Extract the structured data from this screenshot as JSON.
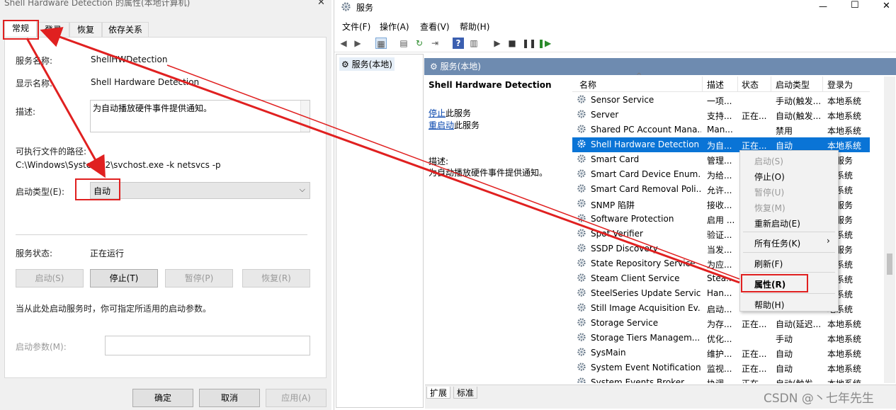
{
  "props": {
    "title": "Shell Hardware Detection 的属性(本地计算机)",
    "close_glyph": "✕",
    "tabs": [
      "常规",
      "登录",
      "恢复",
      "依存关系"
    ],
    "service_name_label": "服务名称:",
    "service_name": "ShellHWDetection",
    "display_name_label": "显示名称:",
    "display_name": "Shell Hardware Detection",
    "description_label": "描述:",
    "description": "为自动播放硬件事件提供通知。",
    "path_label": "可执行文件的路径:",
    "path": "C:\\Windows\\System32\\svchost.exe -k netsvcs -p",
    "startup_type_label": "启动类型(E):",
    "startup_type": "自动",
    "status_label": "服务状态:",
    "status": "正在运行",
    "buttons": {
      "start": "启动(S)",
      "stop": "停止(T)",
      "pause": "暂停(P)",
      "resume": "恢复(R)"
    },
    "hint": "当从此处启动服务时，你可指定所适用的启动参数。",
    "params_label": "启动参数(M):",
    "params_value": "",
    "footer": {
      "ok": "确定",
      "cancel": "取消",
      "apply": "应用(A)"
    }
  },
  "services": {
    "title": "服务",
    "window_controls": {
      "minimize": "—",
      "maximize": "☐",
      "close": "✕"
    },
    "menu": [
      "文件(F)",
      "操作(A)",
      "查看(V)",
      "帮助(H)"
    ],
    "tree_item": "服务(本地)",
    "pane_title": "服务(本地)",
    "detail": {
      "name": "Shell Hardware Detection",
      "stop_link": "停止",
      "stop_suffix": "此服务",
      "restart_link": "重启动",
      "restart_suffix": "此服务",
      "desc_label": "描述:",
      "desc": "为自动播放硬件事件提供通知。"
    },
    "columns": [
      "名称",
      "描述",
      "状态",
      "启动类型",
      "登录为"
    ],
    "rows": [
      {
        "name": "Sensor Service",
        "desc": "一项...",
        "status": "",
        "startup": "手动(触发...",
        "logon": "本地系统"
      },
      {
        "name": "Server",
        "desc": "支持...",
        "status": "正在...",
        "startup": "自动(触发...",
        "logon": "本地系统"
      },
      {
        "name": "Shared PC Account Mana...",
        "desc": "Man...",
        "status": "",
        "startup": "禁用",
        "logon": "本地系统"
      },
      {
        "name": "Shell Hardware Detection",
        "desc": "为自...",
        "status": "正在...",
        "startup": "自动",
        "logon": "本地系统",
        "selected": true
      },
      {
        "name": "Smart Card",
        "desc": "管理...",
        "status": "",
        "startup": "",
        "logon": "地服务"
      },
      {
        "name": "Smart Card Device Enum...",
        "desc": "为给...",
        "status": "",
        "startup": "",
        "logon": "地系统"
      },
      {
        "name": "Smart Card Removal Poli...",
        "desc": "允许...",
        "status": "",
        "startup": "",
        "logon": "地系统"
      },
      {
        "name": "SNMP 陷阱",
        "desc": "接收...",
        "status": "",
        "startup": "",
        "logon": "地服务"
      },
      {
        "name": "Software Protection",
        "desc": "启用 ...",
        "status": "",
        "startup": "",
        "logon": "络服务"
      },
      {
        "name": "Spot Verifier",
        "desc": "验证...",
        "status": "",
        "startup": "",
        "logon": "地系统"
      },
      {
        "name": "SSDP Discovery",
        "desc": "当发...",
        "status": "",
        "startup": "",
        "logon": "地服务"
      },
      {
        "name": "State Repository Service",
        "desc": "为应...",
        "status": "",
        "startup": "",
        "logon": "地系统"
      },
      {
        "name": "Steam Client Service",
        "desc": "Stea...",
        "status": "",
        "startup": "",
        "logon": "地系统"
      },
      {
        "name": "SteelSeries Update Service",
        "desc": "Han...",
        "status": "",
        "startup": "",
        "logon": "地系统"
      },
      {
        "name": "Still Image Acquisition Ev...",
        "desc": "启动...",
        "status": "",
        "startup": "",
        "logon": "地系统"
      },
      {
        "name": "Storage Service",
        "desc": "为存...",
        "status": "正在...",
        "startup": "自动(延迟...",
        "logon": "本地系统"
      },
      {
        "name": "Storage Tiers Managem...",
        "desc": "优化...",
        "status": "",
        "startup": "手动",
        "logon": "本地系统"
      },
      {
        "name": "SysMain",
        "desc": "维护...",
        "status": "正在...",
        "startup": "自动",
        "logon": "本地系统"
      },
      {
        "name": "System Event Notification...",
        "desc": "监视...",
        "status": "正在...",
        "startup": "自动",
        "logon": "本地系统"
      },
      {
        "name": "System Events Broker",
        "desc": "协调...",
        "status": "正在...",
        "startup": "自动(触发...",
        "logon": "本地系统"
      }
    ],
    "bottom_tabs": [
      "扩展",
      "标准"
    ],
    "context_menu": {
      "start": "启动(S)",
      "stop": "停止(O)",
      "pause": "暂停(U)",
      "resume": "恢复(M)",
      "restart": "重新启动(E)",
      "all_tasks": "所有任务(K)",
      "refresh": "刷新(F)",
      "properties": "属性(R)",
      "help": "帮助(H)"
    }
  },
  "watermark": "CSDN @丶七年先生",
  "colors": {
    "annotation": "#e02020",
    "selection": "#0a74d6",
    "pane_header": "#6e8bb0"
  }
}
